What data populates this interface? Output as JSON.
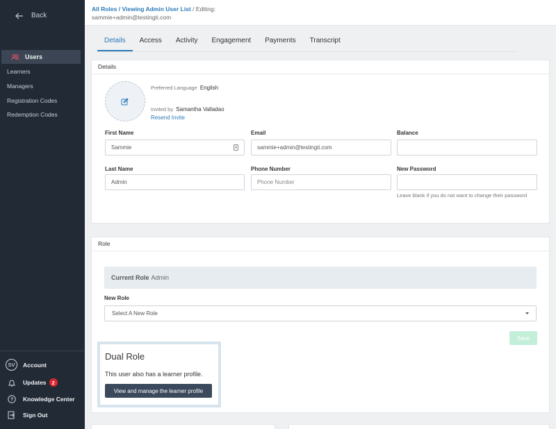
{
  "sidebar": {
    "back_label": "Back",
    "active_item": "Users",
    "items": [
      "Learners",
      "Managers",
      "Registration Codes",
      "Redemption Codes"
    ],
    "bottom": {
      "account_initials": "SV",
      "account_label": "Account",
      "updates_label": "Updates",
      "updates_count": "2",
      "knowledge_label": "Knowledge Center",
      "signout_label": "Sign Out"
    }
  },
  "breadcrumb": {
    "all_roles": "All Roles",
    "viewing": "/ Viewing Admin User List",
    "editing": "/ Editing:",
    "user": "sammie+admin@testingti.com"
  },
  "tabs": [
    "Details",
    "Access",
    "Activity",
    "Engagement",
    "Payments",
    "Transcript"
  ],
  "details": {
    "title": "Details",
    "preferred_language_label": "Preferred Language",
    "preferred_language": "English",
    "invited_by_label": "Invited by",
    "invited_by": "Samantha Valladao",
    "resend": "Resend Invite",
    "fields": {
      "first_name_label": "First Name",
      "first_name": "Sammie",
      "email_label": "Email",
      "email": "sammie+admin@testingti.com",
      "balance_label": "Balance",
      "balance": "",
      "last_name_label": "Last Name",
      "last_name": "Admin",
      "phone_label": "Phone Number",
      "phone_placeholder": "Phone Number",
      "password_label": "New Password",
      "password_hint": "Leave blank if you do not want to change their password"
    }
  },
  "role": {
    "title": "Role",
    "current_label": "Current Role",
    "current_value": "Admin",
    "new_role_label": "New Role",
    "select_placeholder": "Select A New Role",
    "save": "Save"
  },
  "dual": {
    "title": "Dual Role",
    "text": "This user also has a learner profile.",
    "button": "View and manage the learner profile"
  },
  "colors": {
    "accent": "#2b79b8",
    "sidebar": "#222a36",
    "badge": "#e0262f"
  }
}
